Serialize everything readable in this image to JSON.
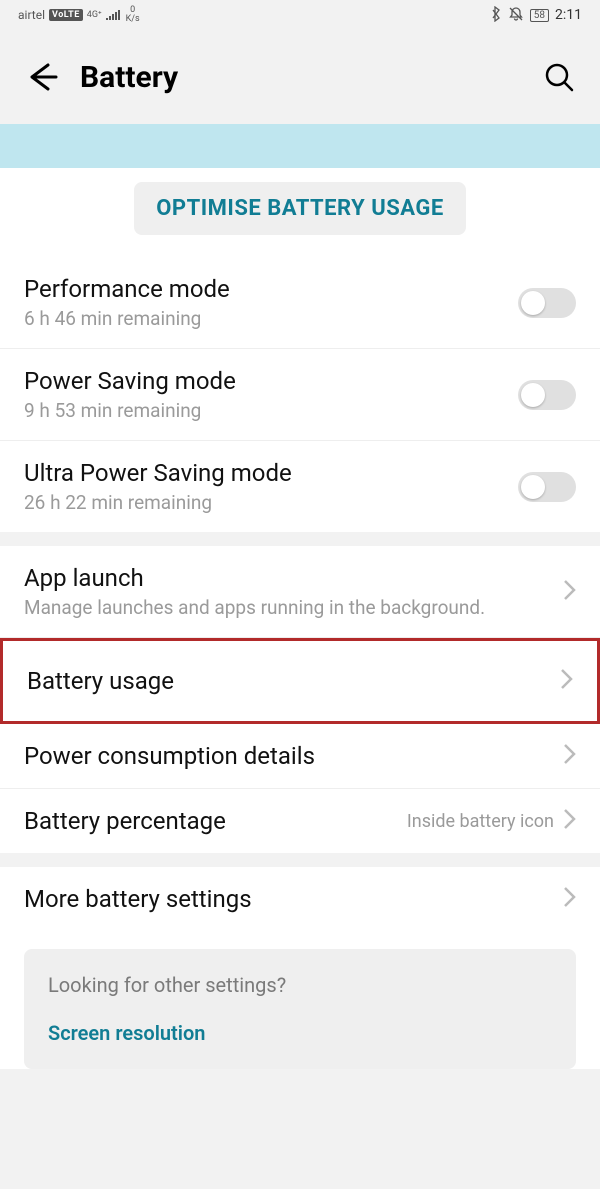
{
  "status": {
    "carrier": "airtel",
    "volte": "VoLTE",
    "net": "4G⁺",
    "speed_top": "0",
    "speed_unit": "K/s",
    "battery": "58",
    "time": "2:11"
  },
  "header": {
    "title": "Battery"
  },
  "optimize_label": "OPTIMISE BATTERY USAGE",
  "modes": [
    {
      "title": "Performance mode",
      "sub": "6 h 46 min remaining"
    },
    {
      "title": "Power Saving mode",
      "sub": "9 h 53 min remaining"
    },
    {
      "title": "Ultra Power Saving mode",
      "sub": "26 h 22 min remaining"
    }
  ],
  "settings1": [
    {
      "title": "App launch",
      "sub": "Manage launches and apps running in the background."
    }
  ],
  "battery_usage_label": "Battery usage",
  "settings2": [
    {
      "title": "Power consumption details"
    }
  ],
  "battery_pct": {
    "title": "Battery percentage",
    "value": "Inside battery icon"
  },
  "more_label": "More battery settings",
  "info": {
    "title": "Looking for other settings?",
    "link": "Screen resolution"
  }
}
